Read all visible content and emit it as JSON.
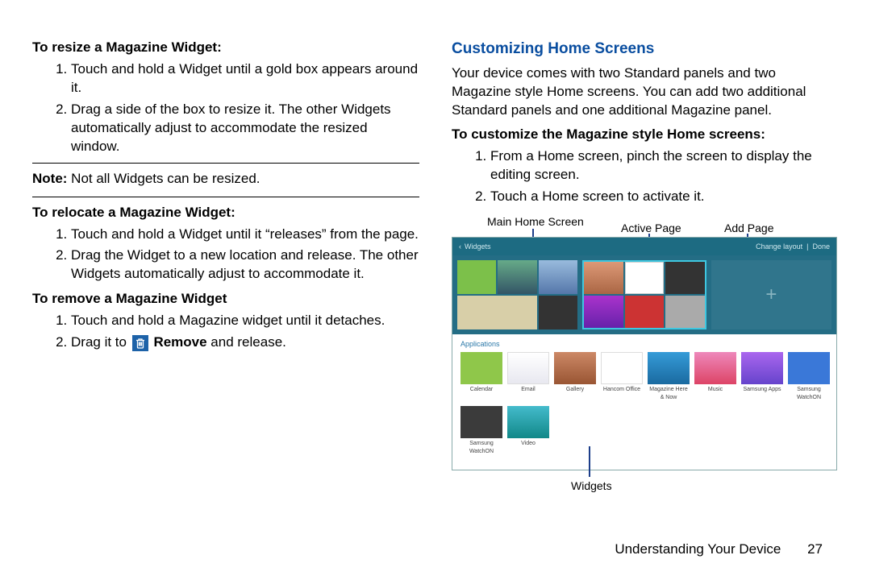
{
  "left": {
    "resize": {
      "title": "To resize a Magazine Widget:",
      "item1": "Touch and hold a Widget until a gold box appears around it.",
      "item2": "Drag a side of the box to resize it. The other Widgets automatically adjust to accommodate the resized window."
    },
    "note_label": "Note:",
    "note_text": " Not all Widgets can be resized.",
    "relocate": {
      "title": "To relocate a Magazine Widget:",
      "item1": "Touch and hold a Widget until it “releases” from the page.",
      "item2": "Drag the Widget to a new location and release. The other Widgets automatically adjust to accommodate it."
    },
    "remove": {
      "title": "To remove a Magazine Widget",
      "item1": "Touch and hold a Magazine widget until it detaches.",
      "item2a": "Drag it to ",
      "item2b": " Remove",
      "item2c": " and release."
    }
  },
  "right": {
    "section_title": "Customizing Home Screens",
    "intro": "Your device comes with two Standard panels and two Magazine style Home screens. You can add two additional Standard panels and one additional Magazine panel.",
    "customize": {
      "title": "To customize the Magazine style Home screens:",
      "item1": "From a Home screen, pinch the screen to display the editing screen.",
      "item2": "Touch a Home screen to activate it."
    },
    "callouts": {
      "main": "Main Home Screen",
      "active": "Active Page",
      "add": "Add Page",
      "widgets": "Widgets"
    },
    "shot": {
      "back_label": "Widgets",
      "change_layout": "Change layout",
      "done": "Done",
      "applications": "Applications",
      "witems": [
        "Calendar",
        "Email",
        "Gallery",
        "Hancom Office",
        "Magazine Here & Now",
        "Music",
        "Samsung Apps",
        "Samsung WatchON",
        "Video"
      ]
    }
  },
  "footer": {
    "chapter": "Understanding Your Device",
    "page": "27"
  }
}
